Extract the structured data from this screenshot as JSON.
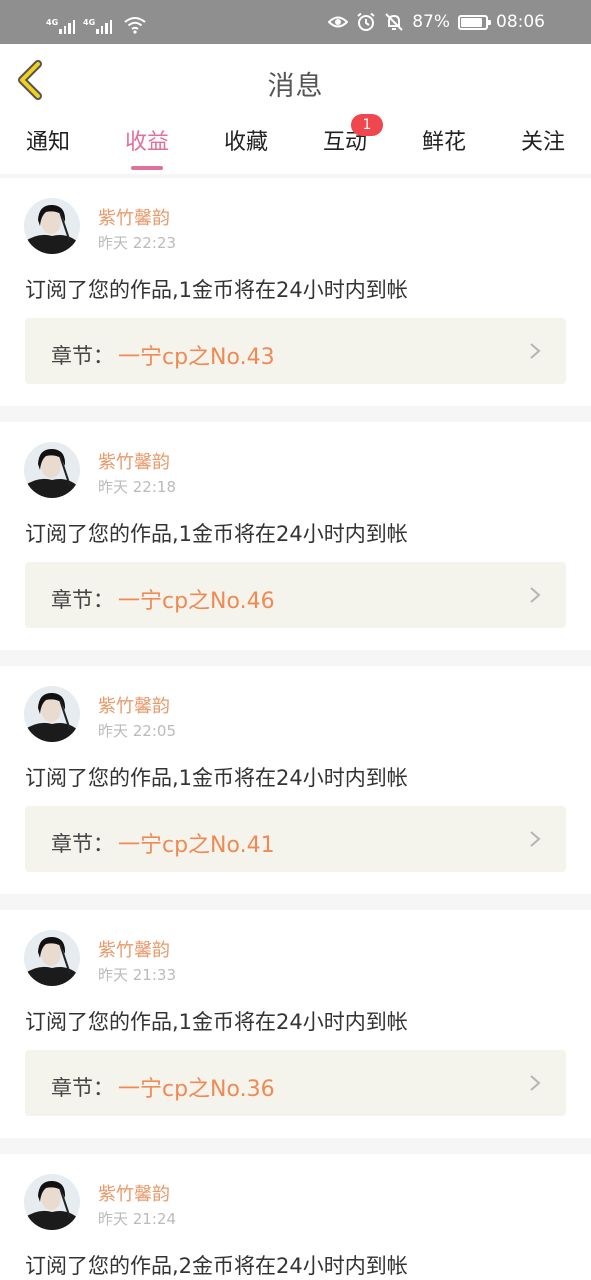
{
  "status_bar": {
    "net1": "4G",
    "net2": "4G",
    "battery_pct_text": "87%",
    "battery_level": 0.87,
    "time": "08:06",
    "icons": [
      "signal-icon",
      "signal-icon",
      "wifi-icon",
      "eye-icon",
      "alarm-icon",
      "mute-bell-icon",
      "battery-icon"
    ]
  },
  "header": {
    "title": "消息",
    "back_icon": "chevron-left-icon"
  },
  "tabs": [
    {
      "label": "通知",
      "active": false
    },
    {
      "label": "收益",
      "active": true
    },
    {
      "label": "收藏",
      "active": false
    },
    {
      "label": "互动",
      "active": false,
      "badge": "1"
    },
    {
      "label": "鲜花",
      "active": false
    },
    {
      "label": "关注",
      "active": false
    }
  ],
  "messages": [
    {
      "user": "紫竹馨韵",
      "time": "昨天 22:23",
      "text": "订阅了您的作品,1金币将在24小时内到帐",
      "chapter_label": "章节：",
      "chapter": "一宁cp之No.43"
    },
    {
      "user": "紫竹馨韵",
      "time": "昨天 22:18",
      "text": "订阅了您的作品,1金币将在24小时内到帐",
      "chapter_label": "章节：",
      "chapter": "一宁cp之No.46"
    },
    {
      "user": "紫竹馨韵",
      "time": "昨天 22:05",
      "text": "订阅了您的作品,1金币将在24小时内到帐",
      "chapter_label": "章节：",
      "chapter": "一宁cp之No.41"
    },
    {
      "user": "紫竹馨韵",
      "time": "昨天 21:33",
      "text": "订阅了您的作品,1金币将在24小时内到帐",
      "chapter_label": "章节：",
      "chapter": "一宁cp之No.36"
    },
    {
      "user": "紫竹馨韵",
      "time": "昨天 21:24",
      "text": "订阅了您的作品,2金币将在24小时内到帐",
      "chapter_label": "",
      "chapter": ""
    }
  ],
  "colors": {
    "accent": "#e36f9b",
    "username": "#e89a6b",
    "chapter": "#f08a55",
    "badge": "#f0474f",
    "back_arrow": "#f2d21b"
  }
}
